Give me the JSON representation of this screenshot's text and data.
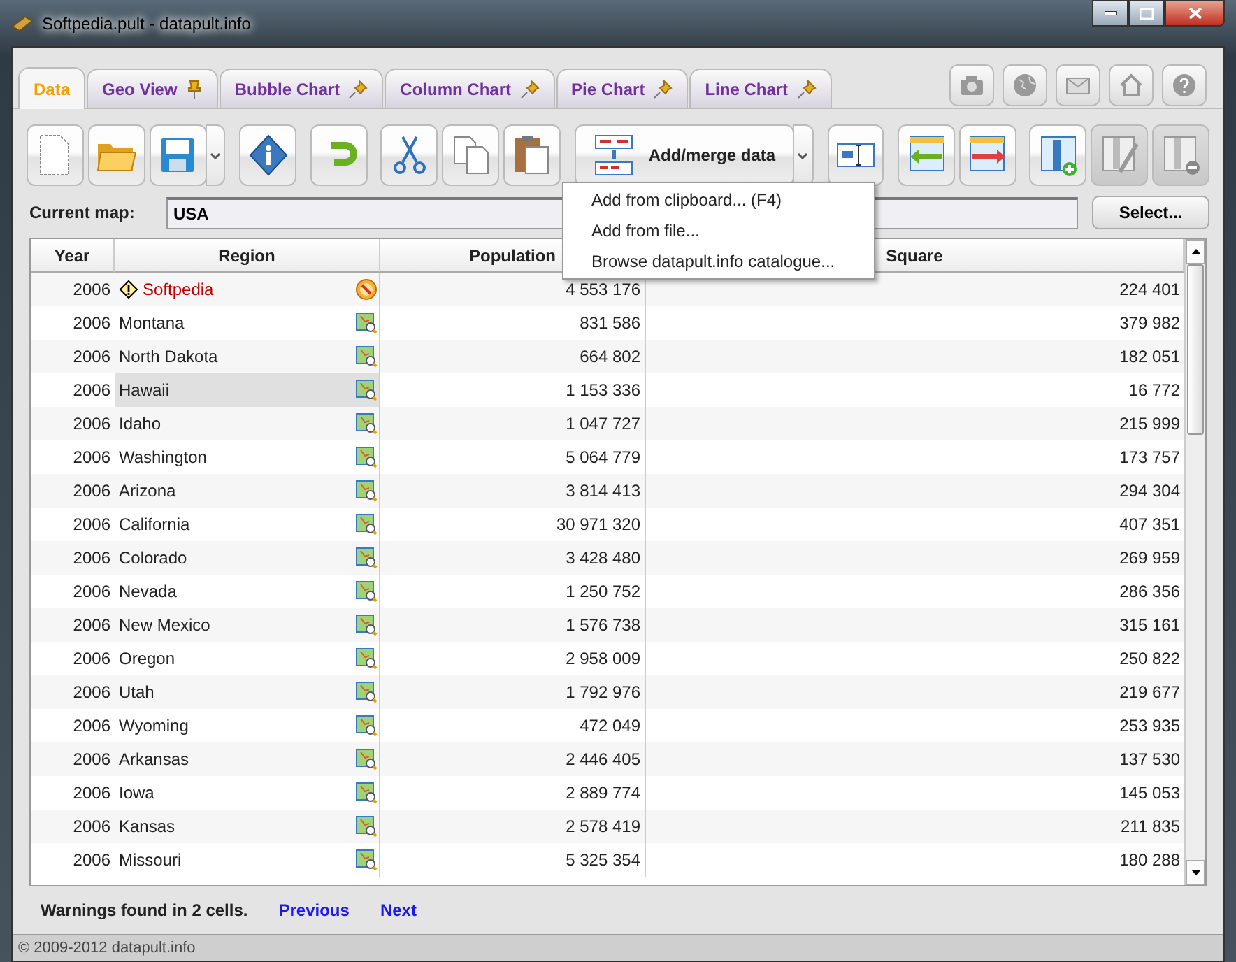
{
  "window": {
    "title": "Softpedia.pult - datapult.info"
  },
  "tabs": [
    {
      "label": "Data",
      "selected": true
    },
    {
      "label": "Geo View",
      "selected": false,
      "pin": {
        "pinned": true
      }
    },
    {
      "label": "Bubble Chart",
      "selected": false,
      "pin": {
        "pinned": false
      }
    },
    {
      "label": "Column Chart",
      "selected": false,
      "pin": {
        "pinned": false
      }
    },
    {
      "label": "Pie Chart",
      "selected": false,
      "pin": {
        "pinned": false
      }
    },
    {
      "label": "Line Chart",
      "selected": false,
      "pin": {
        "pinned": false
      }
    }
  ],
  "toolbar": [
    {
      "kind": "new"
    },
    {
      "kind": "open"
    },
    {
      "kind": "save"
    },
    {
      "kind": "info"
    },
    {
      "kind": "undo"
    },
    {
      "kind": "cut"
    },
    {
      "kind": "copy"
    },
    {
      "kind": "paste"
    },
    {
      "kind": "merge",
      "label": "Add/merge data"
    },
    {
      "kind": "rename"
    },
    {
      "kind": "move-left"
    },
    {
      "kind": "move-right"
    },
    {
      "kind": "add-column"
    },
    {
      "kind": "edit-column",
      "disabled": true
    },
    {
      "kind": "remove-column",
      "disabled": true
    }
  ],
  "menu": [
    "Add from clipboard... (F4)",
    "Add from file...",
    "Browse datapult.info catalogue..."
  ],
  "current_map": {
    "label": "Current map:",
    "value": "USA",
    "button": "Select..."
  },
  "table": {
    "columns": [
      "Year",
      "Region",
      "Population",
      "Square"
    ],
    "rows": [
      {
        "year": "2006",
        "region": "Softpedia",
        "warning": true,
        "selected": false,
        "population": "4 553 176",
        "square": "224 401"
      },
      {
        "year": "2006",
        "region": "Montana",
        "warning": false,
        "selected": false,
        "population": "831 586",
        "square": "379 982"
      },
      {
        "year": "2006",
        "region": "North Dakota",
        "warning": false,
        "selected": false,
        "population": "664 802",
        "square": "182 051"
      },
      {
        "year": "2006",
        "region": "Hawaii",
        "warning": false,
        "selected": true,
        "population": "1 153 336",
        "square": "16 772"
      },
      {
        "year": "2006",
        "region": "Idaho",
        "warning": false,
        "selected": false,
        "population": "1 047 727",
        "square": "215 999"
      },
      {
        "year": "2006",
        "region": "Washington",
        "warning": false,
        "selected": false,
        "population": "5 064 779",
        "square": "173 757"
      },
      {
        "year": "2006",
        "region": "Arizona",
        "warning": false,
        "selected": false,
        "population": "3 814 413",
        "square": "294 304"
      },
      {
        "year": "2006",
        "region": "California",
        "warning": false,
        "selected": false,
        "population": "30 971 320",
        "square": "407 351"
      },
      {
        "year": "2006",
        "region": "Colorado",
        "warning": false,
        "selected": false,
        "population": "3 428 480",
        "square": "269 959"
      },
      {
        "year": "2006",
        "region": "Nevada",
        "warning": false,
        "selected": false,
        "population": "1 250 752",
        "square": "286 356"
      },
      {
        "year": "2006",
        "region": "New Mexico",
        "warning": false,
        "selected": false,
        "population": "1 576 738",
        "square": "315 161"
      },
      {
        "year": "2006",
        "region": "Oregon",
        "warning": false,
        "selected": false,
        "population": "2 958 009",
        "square": "250 822"
      },
      {
        "year": "2006",
        "region": "Utah",
        "warning": false,
        "selected": false,
        "population": "1 792 976",
        "square": "219 677"
      },
      {
        "year": "2006",
        "region": "Wyoming",
        "warning": false,
        "selected": false,
        "population": "472 049",
        "square": "253 935"
      },
      {
        "year": "2006",
        "region": "Arkansas",
        "warning": false,
        "selected": false,
        "population": "2 446 405",
        "square": "137 530"
      },
      {
        "year": "2006",
        "region": "Iowa",
        "warning": false,
        "selected": false,
        "population": "2 889 774",
        "square": "145 053"
      },
      {
        "year": "2006",
        "region": "Kansas",
        "warning": false,
        "selected": false,
        "population": "2 578 419",
        "square": "211 835"
      },
      {
        "year": "2006",
        "region": "Missouri",
        "warning": false,
        "selected": false,
        "population": "5 325 354",
        "square": "180 288"
      }
    ]
  },
  "footer": {
    "message": "Warnings found in 2 cells.",
    "links": [
      "Previous",
      "Next"
    ]
  },
  "status_bar": "© 2009-2012 datapult.info"
}
